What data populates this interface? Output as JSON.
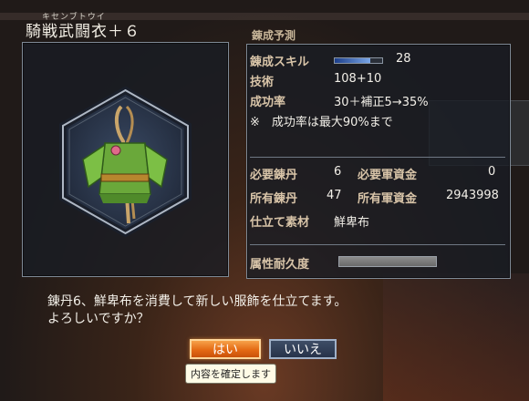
{
  "item": {
    "kana": "キセンブトウイ",
    "name": "騎戦武闘衣＋６",
    "icon": "green-armor-robe-icon"
  },
  "section_title": "錬成予測",
  "stats": {
    "skill_label": "錬成スキル",
    "skill_value": "28",
    "skill_fill": 0.75,
    "tech_label": "技術",
    "tech_value": "108+10",
    "rate_label": "成功率",
    "rate_value": "30＋補正5→35%",
    "note": "※　成功率は最大90%まで",
    "need_dan_label": "必要錬丹",
    "need_dan_value": "6",
    "need_money_label": "必要軍資金",
    "need_money_value": "0",
    "own_dan_label": "所有錬丹",
    "own_dan_value": "47",
    "own_money_label": "所有軍資金",
    "own_money_value": "2943998",
    "material_label": "仕立て素材",
    "material_value": "鮮卑布",
    "durability_label": "属性耐久度",
    "durability_fill": 1.0
  },
  "message": {
    "line1": "錬丹6、鮮卑布を消費して新しい服飾を仕立てます。",
    "line2": "よろしいですか？"
  },
  "buttons": {
    "yes": "はい",
    "no": "いいえ"
  },
  "tooltip": "内容を確定します",
  "colors": {
    "accent_yes": "#e46a14",
    "accent_no": "#27334a",
    "label": "#d8c4a8"
  }
}
